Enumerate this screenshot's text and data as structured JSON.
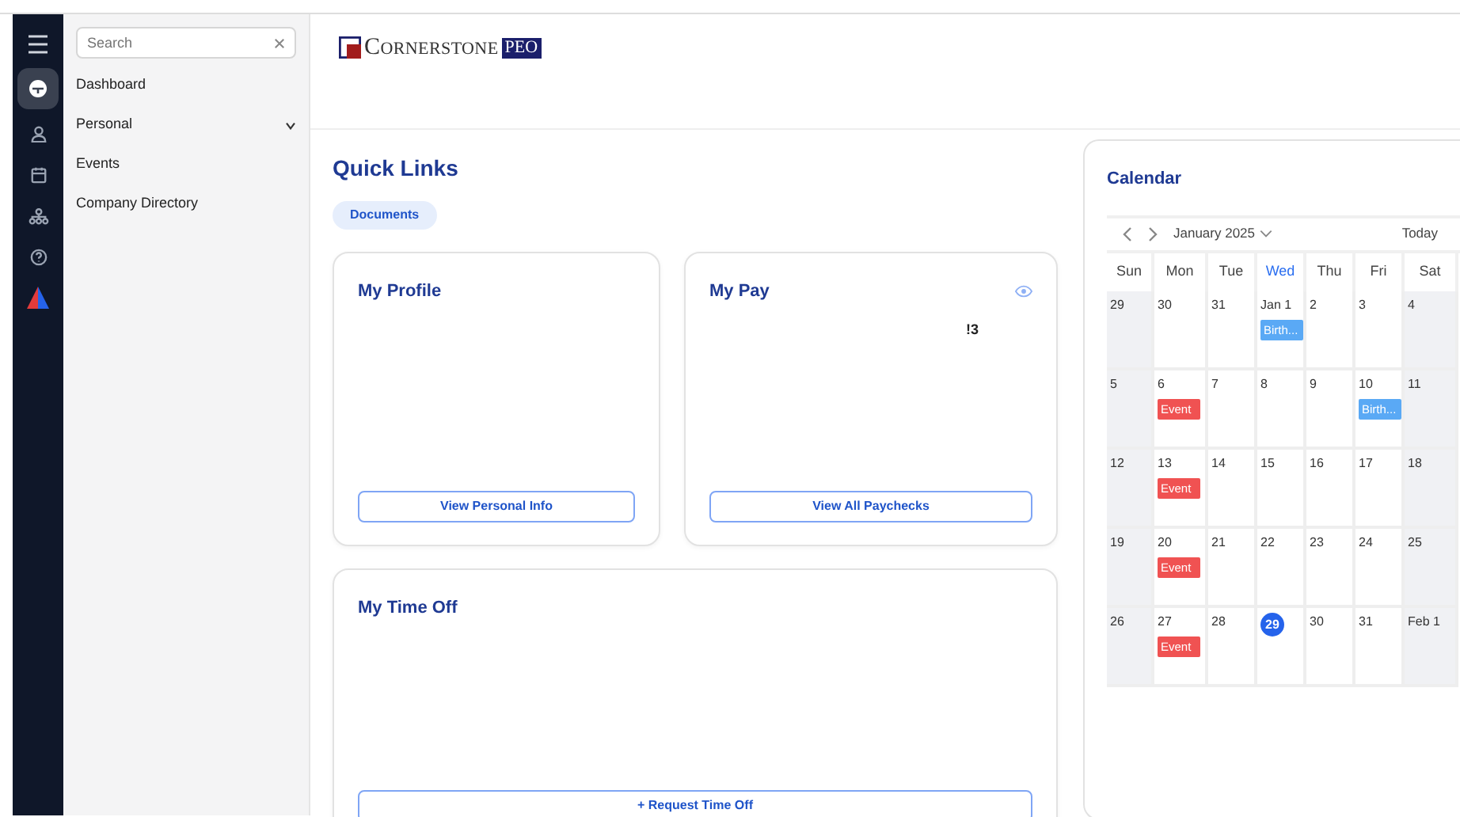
{
  "nav_rail": [
    {
      "kind": "menu",
      "selected": false
    },
    {
      "kind": "dashboard",
      "selected": true
    },
    {
      "kind": "person",
      "selected": false
    },
    {
      "kind": "calendar",
      "selected": false
    },
    {
      "kind": "org",
      "selected": false
    },
    {
      "kind": "help",
      "selected": false
    },
    {
      "kind": "brand",
      "selected": false
    }
  ],
  "sidebar": {
    "search": {
      "placeholder": "Search"
    },
    "items": [
      {
        "label": "Dashboard",
        "kind": "link"
      },
      {
        "label": "Personal",
        "kind": "group",
        "expanded": false
      },
      {
        "label": "Events",
        "kind": "link"
      },
      {
        "label": "Company Directory",
        "kind": "link"
      }
    ]
  },
  "header": {
    "logo": {
      "name": "CORNERSTONE",
      "badge": "PEO"
    }
  },
  "quick_links": {
    "title": "Quick Links",
    "chips": [
      "Documents"
    ]
  },
  "cards": [
    {
      "kind": "profile",
      "title": "My Profile",
      "button": "View Personal Info"
    },
    {
      "kind": "pay",
      "title": "My Pay",
      "note": "!3",
      "button": "View All Paychecks"
    },
    {
      "kind": "timeoff",
      "title": "My Time Off",
      "button": "+ Request Time Off"
    }
  ],
  "calendar": {
    "title": "Calendar",
    "month": "January 2025",
    "today_button": "Today",
    "weekdays": [
      {
        "label": "Sun",
        "selected": false
      },
      {
        "label": "Mon",
        "selected": false
      },
      {
        "label": "Tue",
        "selected": false
      },
      {
        "label": "Wed",
        "selected": true
      },
      {
        "label": "Thu",
        "selected": false
      },
      {
        "label": "Fri",
        "selected": false
      },
      {
        "label": "Sat",
        "selected": false
      }
    ],
    "weeks": [
      [
        {
          "label": "29",
          "today": false
        },
        {
          "label": "30",
          "today": false
        },
        {
          "label": "31",
          "today": false
        },
        {
          "label": "Jan 1",
          "today": false,
          "events": [
            {
              "label": "Birth...",
              "color": "#5aa9f5"
            }
          ]
        },
        {
          "label": "2",
          "today": false
        },
        {
          "label": "3",
          "today": false
        },
        {
          "label": "4",
          "today": false
        }
      ],
      [
        {
          "label": "5",
          "today": false
        },
        {
          "label": "6",
          "today": false,
          "events": [
            {
              "label": "Event",
              "color": "#f05252"
            }
          ]
        },
        {
          "label": "7",
          "today": false
        },
        {
          "label": "8",
          "today": false
        },
        {
          "label": "9",
          "today": false
        },
        {
          "label": "10",
          "today": false,
          "events": [
            {
              "label": "Birth...",
              "color": "#5aa9f5"
            }
          ]
        },
        {
          "label": "11",
          "today": false
        }
      ],
      [
        {
          "label": "12",
          "today": false
        },
        {
          "label": "13",
          "today": false,
          "events": [
            {
              "label": "Event",
              "color": "#f05252"
            }
          ]
        },
        {
          "label": "14",
          "today": false
        },
        {
          "label": "15",
          "today": false
        },
        {
          "label": "16",
          "today": false
        },
        {
          "label": "17",
          "today": false
        },
        {
          "label": "18",
          "today": false
        }
      ],
      [
        {
          "label": "19",
          "today": false
        },
        {
          "label": "20",
          "today": false,
          "events": [
            {
              "label": "Event",
              "color": "#f05252"
            }
          ]
        },
        {
          "label": "21",
          "today": false
        },
        {
          "label": "22",
          "today": false
        },
        {
          "label": "23",
          "today": false
        },
        {
          "label": "24",
          "today": false
        },
        {
          "label": "25",
          "today": false
        }
      ],
      [
        {
          "label": "26",
          "today": false
        },
        {
          "label": "27",
          "today": false,
          "events": [
            {
              "label": "Event",
              "color": "#f05252"
            }
          ]
        },
        {
          "label": "28",
          "today": false
        },
        {
          "label": "29",
          "today": true
        },
        {
          "label": "30",
          "today": false
        },
        {
          "label": "31",
          "today": false
        },
        {
          "label": "Feb 1",
          "today": false
        }
      ]
    ]
  }
}
